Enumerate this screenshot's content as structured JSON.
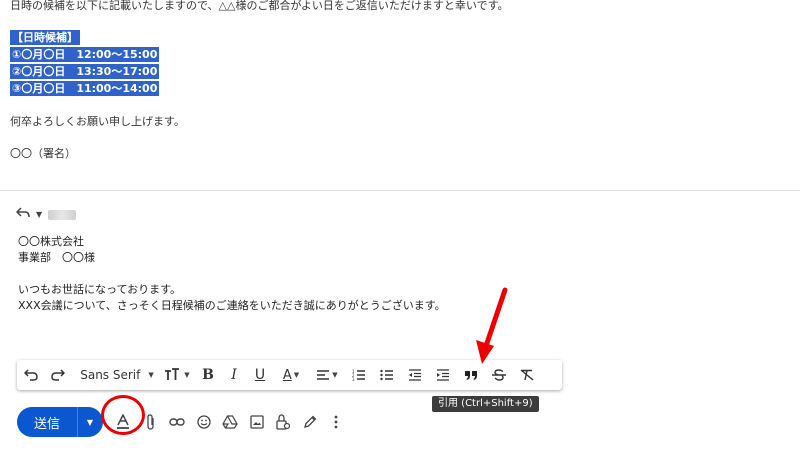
{
  "quoted_message": {
    "intro": "日時の候補を以下に記載いたしますので、△△様のご都合がよい日をご返信いただけますと幸いです。",
    "schedule_heading": "【日時候補】",
    "schedule_options": [
      "①〇月〇日　12:00～15:00",
      "②〇月〇日　13:30～17:00",
      "③〇月〇日　11:00～14:00"
    ],
    "closing": "何卒よろしくお願い申し上げます。",
    "signature": "〇〇（署名）"
  },
  "compose": {
    "body_lines": [
      "〇〇株式会社",
      "事業部　〇〇様",
      "",
      "いつもお世話になっております。",
      "XXX会議について、さっそく日程候補のご連絡をいただき誠にありがとうございます。"
    ],
    "toolbar": {
      "font_label": "Sans Serif"
    },
    "tooltip": "引用 (Ctrl+Shift+9)",
    "send_label": "送信"
  },
  "icons": {
    "reply": "reply-icon",
    "undo": "undo-icon",
    "redo": "redo-icon",
    "text_size": "text-size-icon",
    "bold": "bold-icon",
    "italic": "italic-icon",
    "underline": "underline-icon",
    "text_color": "text-color-icon",
    "align": "align-icon",
    "numbered_list": "numbered-list-icon",
    "bulleted_list": "bulleted-list-icon",
    "indent_less": "indent-less-icon",
    "indent_more": "indent-more-icon",
    "quote": "quote-icon",
    "strikethrough": "strikethrough-icon",
    "clear_formatting": "clear-formatting-icon",
    "formatting_options": "formatting-options-icon",
    "attach": "attach-icon",
    "link": "link-icon",
    "emoji": "emoji-icon",
    "drive": "drive-icon",
    "photo": "photo-icon",
    "confidential": "confidential-mode-icon",
    "signature": "signature-pen-icon",
    "more": "more-options-icon"
  },
  "colors": {
    "send_button": "#0b57d0",
    "selection": "#2f63c9",
    "annotation_red": "#e00000"
  }
}
